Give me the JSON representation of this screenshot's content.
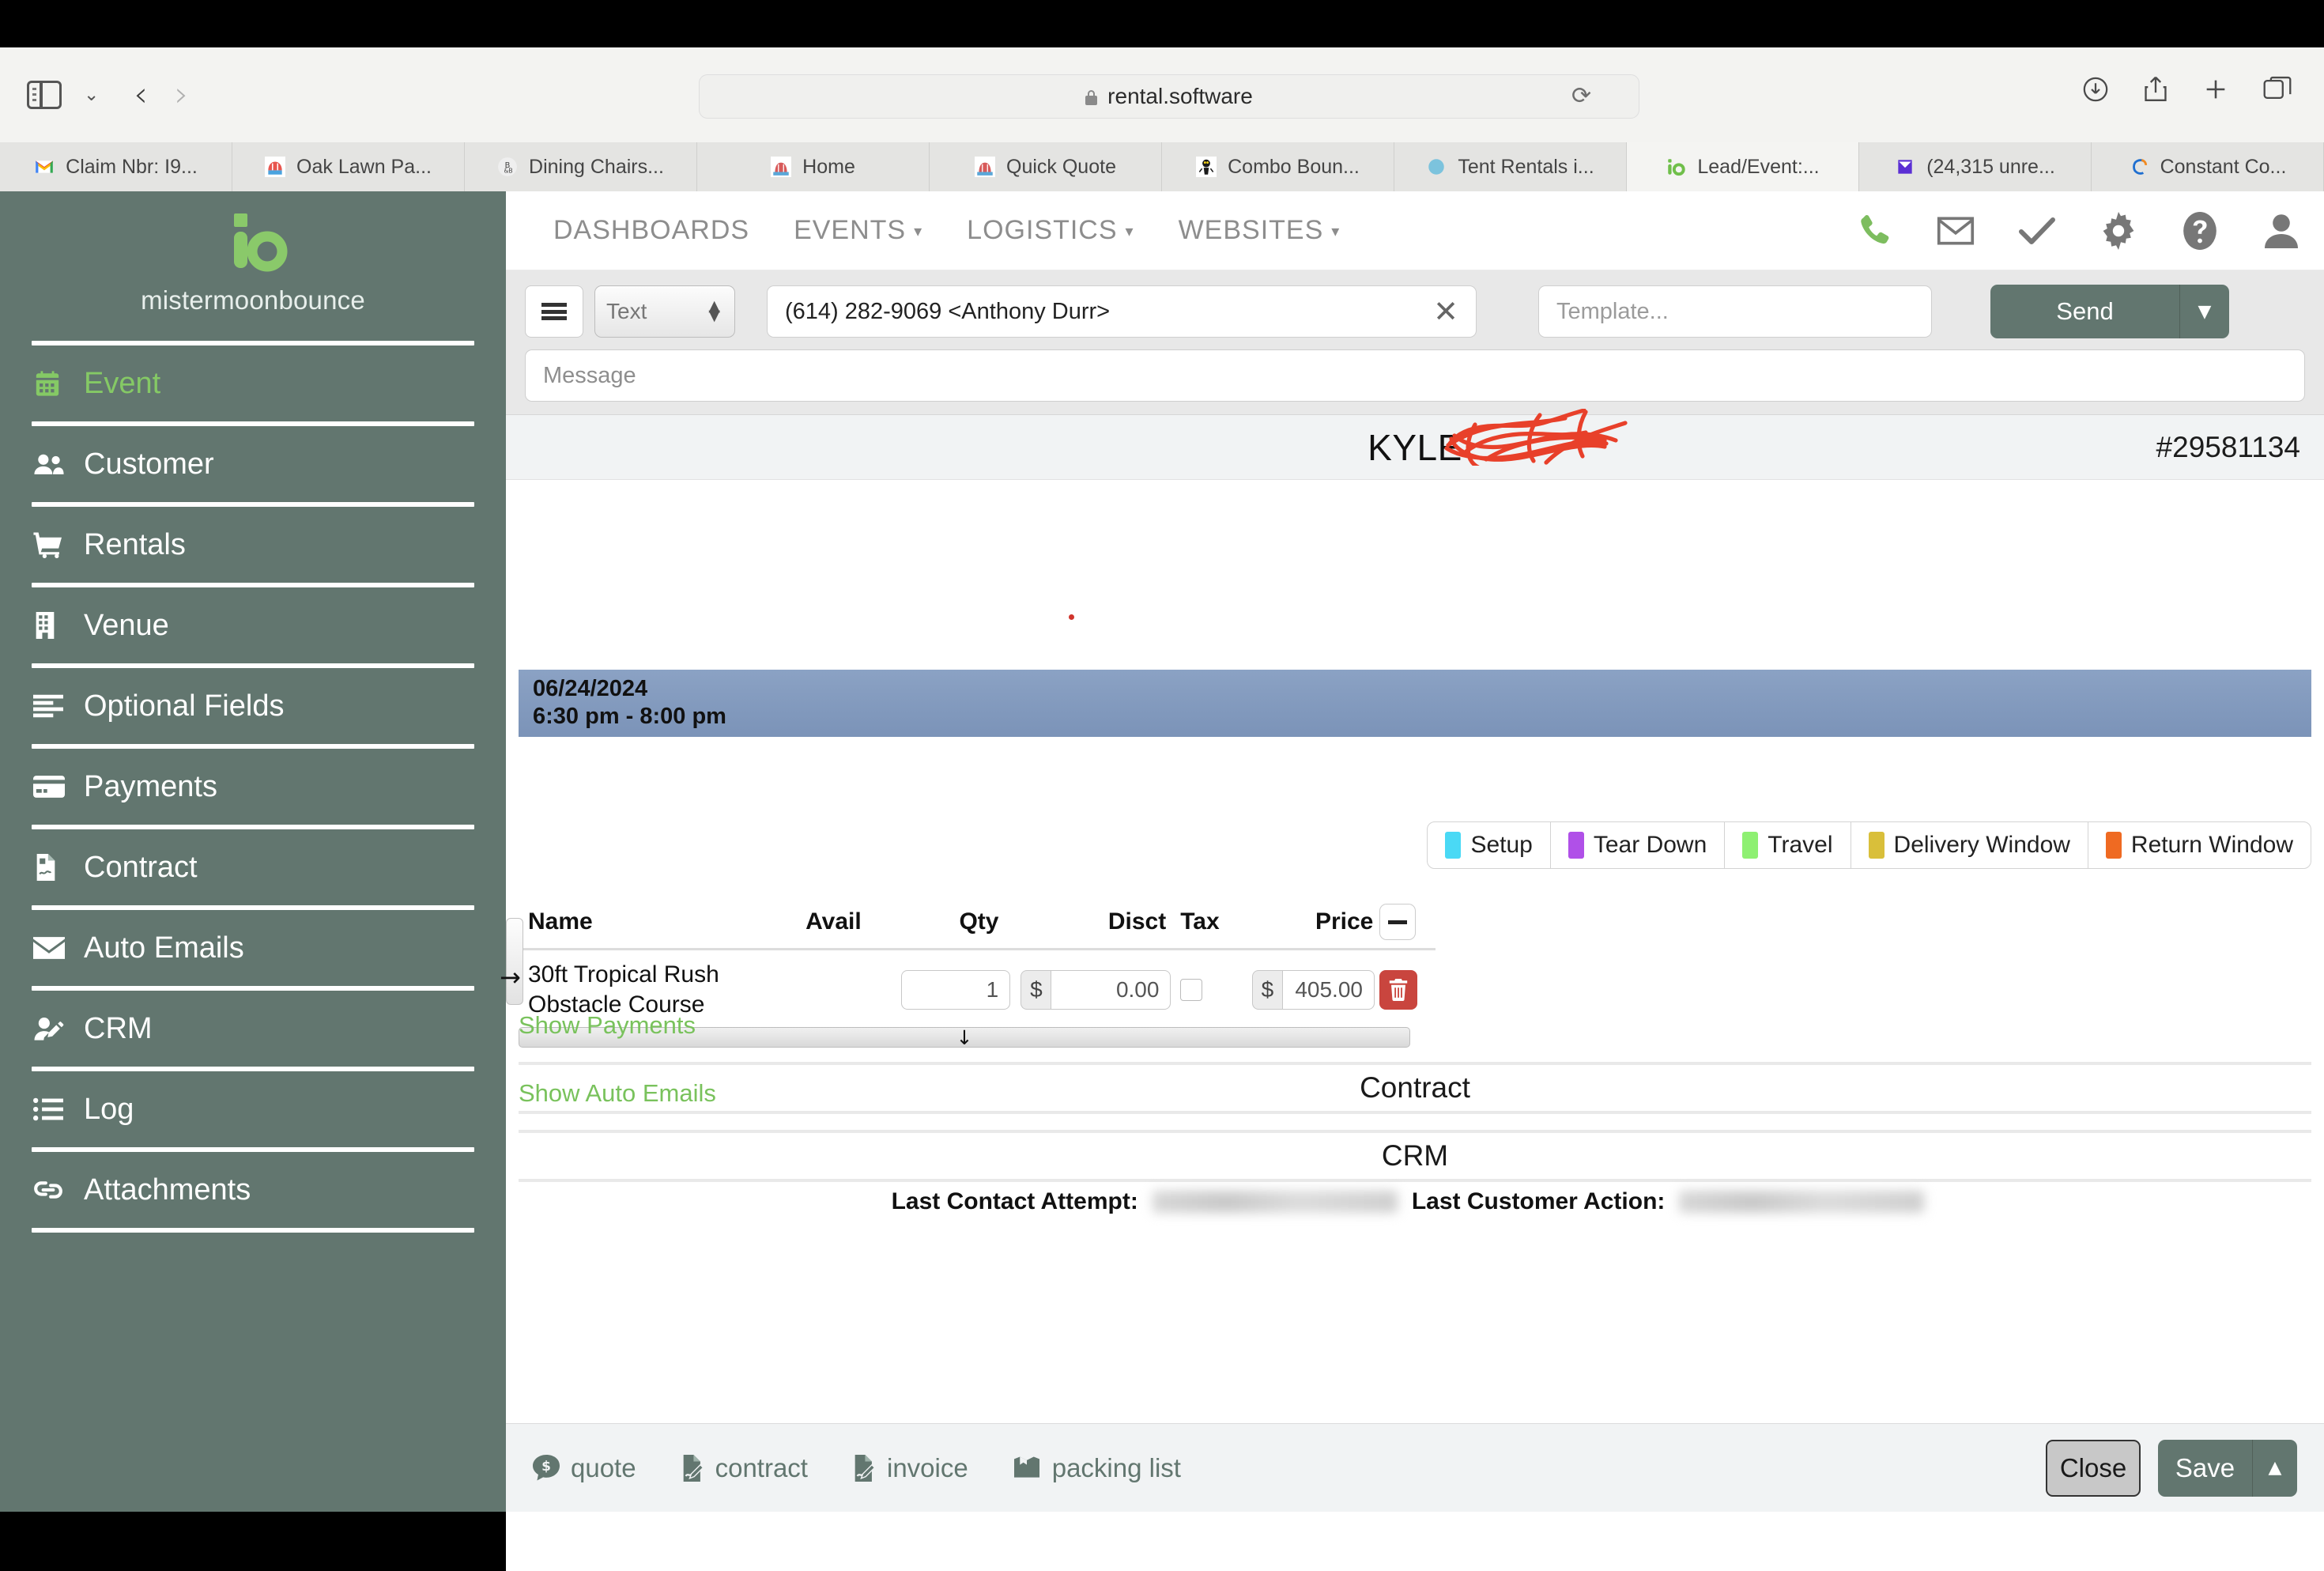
{
  "browser": {
    "url": "rental.software",
    "lock_icon": "lock-icon",
    "reload_icon": "reload-icon",
    "sidebar_toggle_icon": "sidebar-toggle-icon",
    "back_icon": "back-arrow-icon",
    "forward_icon": "forward-arrow-icon",
    "downloads_icon": "downloads-icon",
    "share_icon": "share-icon",
    "new_tab_icon": "plus-icon",
    "tab_overview_icon": "tab-overview-icon",
    "tabs": [
      {
        "title": "Claim Nbr: I9...",
        "favicon": "gmail-icon",
        "active": false
      },
      {
        "title": "Oak Lawn Pa...",
        "favicon": "bouncehouse-icon",
        "active": false
      },
      {
        "title": "Dining Chairs...",
        "favicon": "b-and-b-icon",
        "active": false
      },
      {
        "title": "Home",
        "favicon": "bouncer-icon",
        "active": false
      },
      {
        "title": "Quick Quote",
        "favicon": "bouncer-icon",
        "active": false
      },
      {
        "title": "Combo Boun...",
        "favicon": "mascot-icon",
        "active": false
      },
      {
        "title": "Tent Rentals i...",
        "favicon": "blue-circle-icon",
        "active": false
      },
      {
        "title": "Lead/Event:...",
        "favicon": "io-logo-icon",
        "active": true
      },
      {
        "title": "(24,315 unre...",
        "favicon": "outlook-icon",
        "active": false
      },
      {
        "title": "Constant Co...",
        "favicon": "constant-contact-icon",
        "active": false
      }
    ]
  },
  "sidebar": {
    "brand_name": "mistermoonbounce",
    "brand_logo": "io-logo-icon",
    "items": [
      {
        "label": "Event",
        "icon": "calendar-icon",
        "active": true
      },
      {
        "label": "Customer",
        "icon": "users-icon",
        "active": false
      },
      {
        "label": "Rentals",
        "icon": "shopping-cart-icon",
        "active": false
      },
      {
        "label": "Venue",
        "icon": "building-icon",
        "active": false
      },
      {
        "label": "Optional Fields",
        "icon": "align-left-icon",
        "active": false
      },
      {
        "label": "Payments",
        "icon": "credit-card-icon",
        "active": false
      },
      {
        "label": "Contract",
        "icon": "file-signature-icon",
        "active": false
      },
      {
        "label": "Auto Emails",
        "icon": "envelope-icon",
        "active": false
      },
      {
        "label": "CRM",
        "icon": "user-edit-icon",
        "active": false
      },
      {
        "label": "Log",
        "icon": "list-icon",
        "active": false
      },
      {
        "label": "Attachments",
        "icon": "link-icon",
        "active": false
      }
    ]
  },
  "topnav": {
    "items": [
      {
        "label": "DASHBOARDS",
        "has_caret": false
      },
      {
        "label": "EVENTS",
        "has_caret": true
      },
      {
        "label": "LOGISTICS",
        "has_caret": true
      },
      {
        "label": "WEBSITES",
        "has_caret": true
      }
    ],
    "icons": [
      {
        "name": "phone-icon",
        "color": "#7dbd5f"
      },
      {
        "name": "envelope-icon",
        "color": "#777777"
      },
      {
        "name": "check-icon",
        "color": "#777777"
      },
      {
        "name": "gear-icon",
        "color": "#777777"
      },
      {
        "name": "help-circle-icon",
        "color": "#777777"
      },
      {
        "name": "user-account-icon",
        "color": "#777777"
      }
    ]
  },
  "message_bar": {
    "menu_icon": "hamburger-icon",
    "type_value": "Text",
    "recipient_value": "(614) 282-9069 <Anthony Durr>",
    "clear_icon": "close-x-icon",
    "template_placeholder": "Template...",
    "send_label": "Send",
    "send_caret_icon": "chevron-down-icon",
    "message_placeholder": "Message"
  },
  "header": {
    "event_title": "KYLE",
    "redaction": "red-scribble-redaction",
    "event_id": "#29581134"
  },
  "event": {
    "date": "06/24/2024",
    "time_range": "6:30 pm - 8:00 pm"
  },
  "legend": [
    {
      "label": "Setup",
      "color": "#4ad9f5"
    },
    {
      "label": "Tear Down",
      "color": "#b050e8"
    },
    {
      "label": "Travel",
      "color": "#8ef072"
    },
    {
      "label": "Delivery Window",
      "color": "#d9bf3a"
    },
    {
      "label": "Return Window",
      "color": "#ef6a22"
    }
  ],
  "items_table": {
    "columns": [
      "Name",
      "Avail",
      "Qty",
      "Disct",
      "Tax",
      "Price"
    ],
    "collapse_icon": "minus-icon",
    "rows": [
      {
        "name": "30ft Tropical Rush Obstacle Course",
        "avail": "",
        "qty": "1",
        "disct_currency": "$",
        "disct": "0.00",
        "tax_checked": false,
        "price_currency": "$",
        "price": "405.00",
        "delete_icon": "trash-icon"
      }
    ],
    "expand_icon": "arrow-down-icon",
    "row_handle_icon": "arrow-right-icon"
  },
  "sections": {
    "show_payments": "Show Payments",
    "contract_title": "Contract",
    "show_auto_emails": "Show Auto Emails",
    "crm_title": "CRM",
    "last_contact_attempt_label": "Last Contact Attempt:",
    "last_contact_attempt_value": "",
    "last_customer_action_label": "Last Customer Action:",
    "last_customer_action_value": ""
  },
  "footer": {
    "links": [
      {
        "label": "quote",
        "icon": "quote-bubble-icon"
      },
      {
        "label": "contract",
        "icon": "file-signature-icon"
      },
      {
        "label": "invoice",
        "icon": "file-signature-icon"
      },
      {
        "label": "packing list",
        "icon": "box-icon"
      }
    ],
    "close_label": "Close",
    "save_label": "Save",
    "save_caret_icon": "chevron-up-icon"
  },
  "colors": {
    "sidebar_bg": "#62766f",
    "accent_green": "#85c965",
    "link_green": "#79c25c",
    "date_bar": "#7f97bc",
    "danger_red": "#c9453e",
    "redaction_red": "#e8402a"
  }
}
